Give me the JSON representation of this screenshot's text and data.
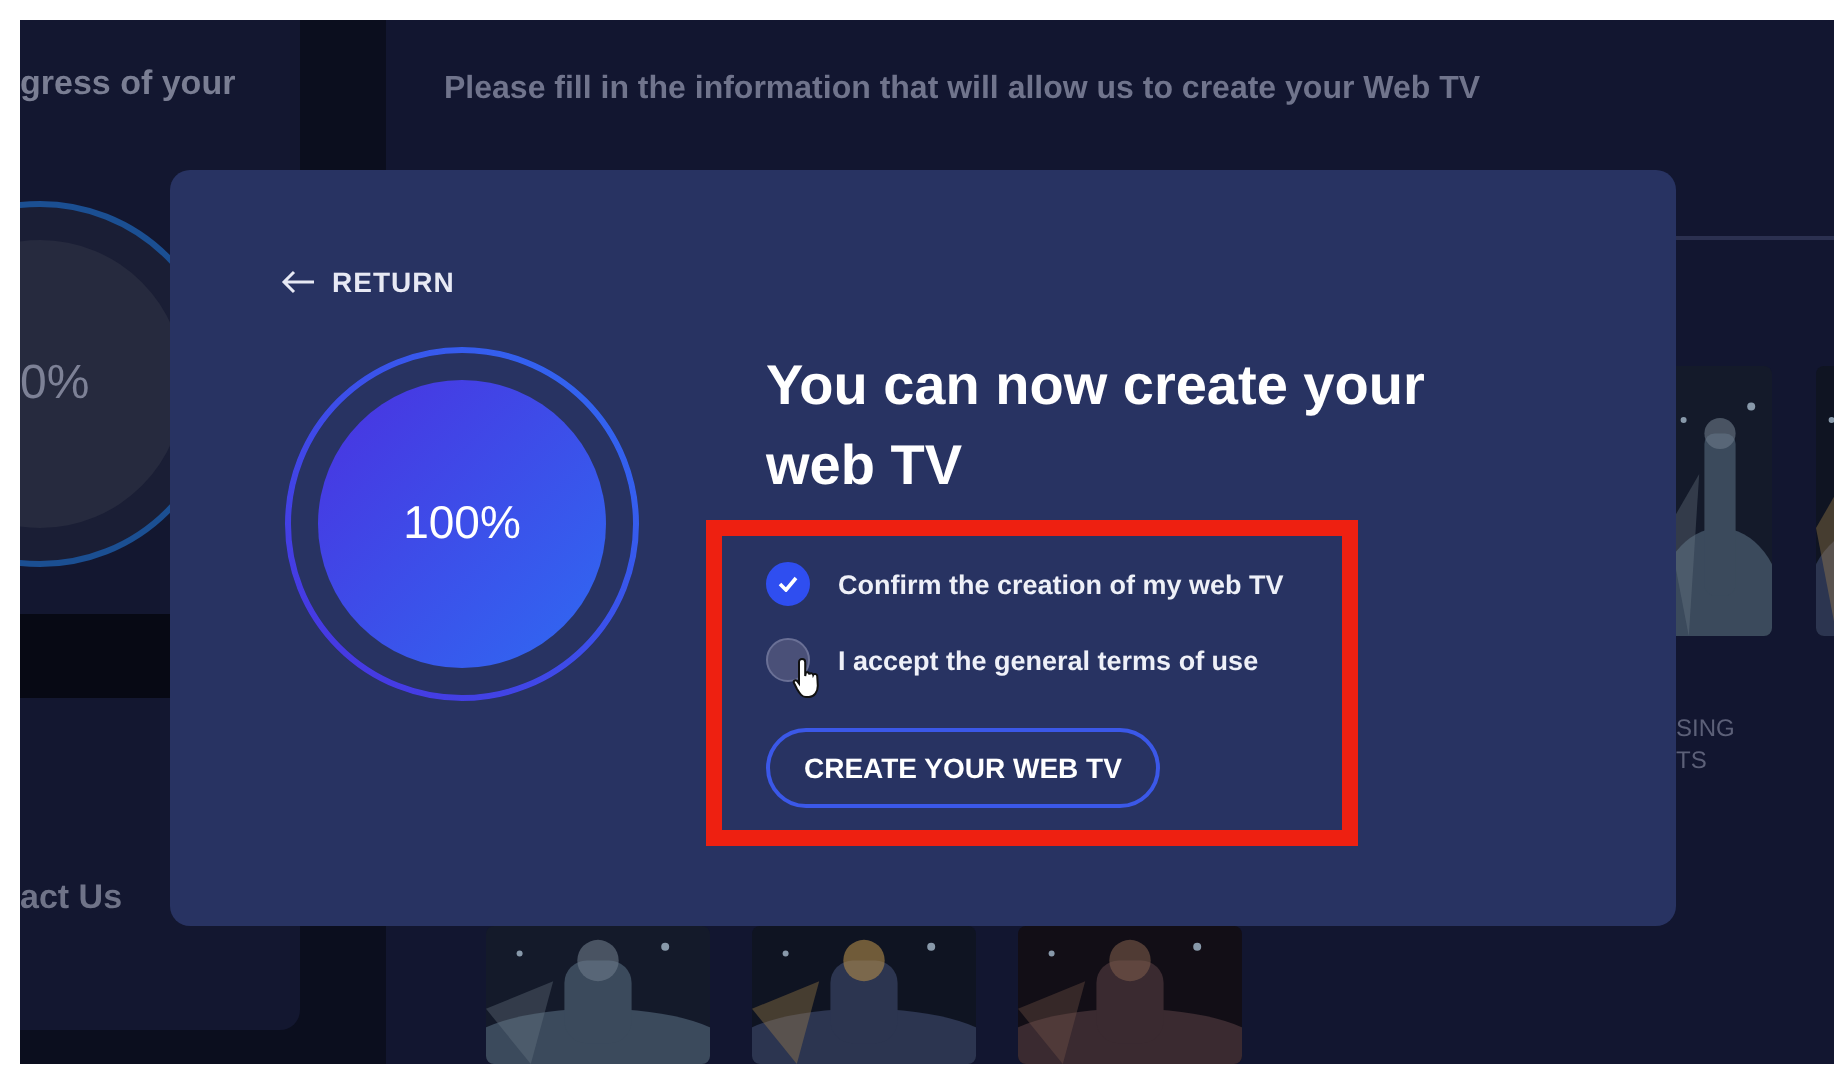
{
  "background": {
    "sidebar": {
      "heading": "gress of your",
      "progress": "0%",
      "link": "act Us"
    },
    "main": {
      "heading": "Please fill in the information that will allow us to create your Web TV",
      "captions": [
        "SING",
        "TS"
      ]
    }
  },
  "modal": {
    "return": "RETURN",
    "progress": {
      "label": "100%",
      "level": 1
    },
    "title": "You can now create your web TV",
    "checks": [
      {
        "label": "Confirm the creation of my web TV",
        "checked": true
      },
      {
        "label": "I accept the general terms of use",
        "checked": false
      }
    ],
    "button": "CREATE YOUR WEB TV"
  }
}
